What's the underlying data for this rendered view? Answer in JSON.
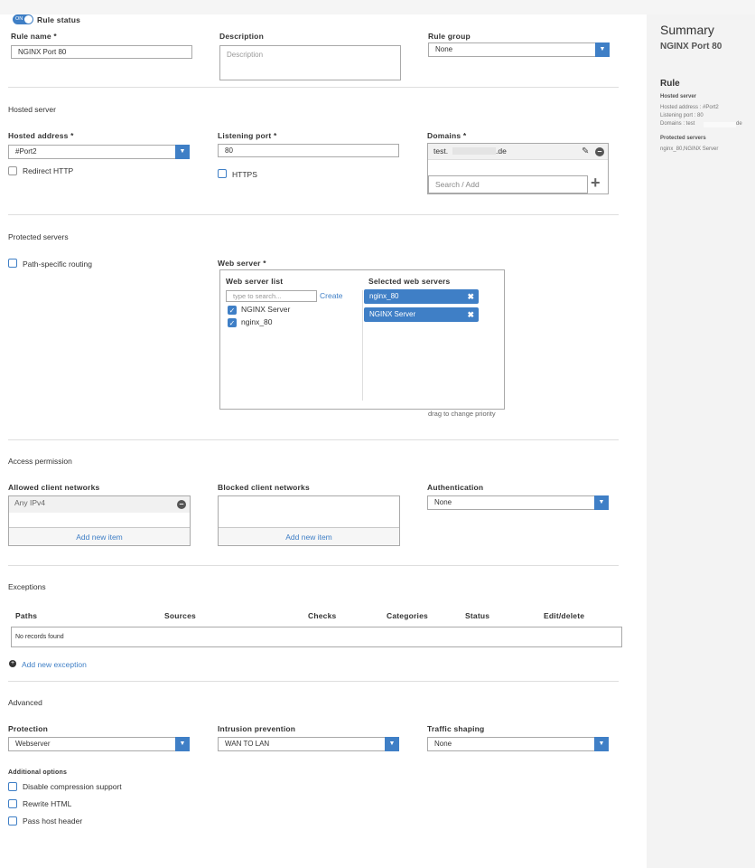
{
  "rule": {
    "status_label": "Rule status",
    "toggle_text": "ON",
    "name_label": "Rule name *",
    "name_value": "NGINX Port 80",
    "description_label": "Description",
    "description_placeholder": "Description",
    "group_label": "Rule group",
    "group_value": "None"
  },
  "hosted": {
    "title": "Hosted server",
    "address_label": "Hosted address *",
    "address_value": "#Port2",
    "redirect_http": "Redirect HTTP",
    "port_label": "Listening port *",
    "port_value": "80",
    "https_label": "HTTPS",
    "domains_label": "Domains *",
    "domain_prefix": "test.",
    "domain_suffix": ".de",
    "domain_search_placeholder": "Search / Add"
  },
  "protected": {
    "title": "Protected servers",
    "path_routing": "Path-specific routing",
    "web_server_label": "Web server *",
    "list_title": "Web server list",
    "search_placeholder": "type to search...",
    "create_link": "Create",
    "list_items": [
      "NGINX Server",
      "nginx_80"
    ],
    "selected_title": "Selected web servers",
    "selected_items": [
      "nginx_80",
      "NGINX Server"
    ],
    "drag_hint": "drag to change priority"
  },
  "access": {
    "title": "Access permission",
    "allowed_label": "Allowed client networks",
    "allowed_item": "Any IPv4",
    "add_item": "Add new item",
    "blocked_label": "Blocked client networks",
    "auth_label": "Authentication",
    "auth_value": "None"
  },
  "exceptions": {
    "title": "Exceptions",
    "columns": [
      "Paths",
      "Sources",
      "Checks",
      "Categories",
      "Status",
      "Edit/delete"
    ],
    "empty": "No records found",
    "add_exception": "Add new exception"
  },
  "advanced": {
    "title": "Advanced",
    "protection_label": "Protection",
    "protection_value": "Webserver",
    "ips_label": "Intrusion prevention",
    "ips_value": "WAN TO LAN",
    "shaping_label": "Traffic shaping",
    "shaping_value": "None",
    "additional_label": "Additional options",
    "options": [
      "Disable compression support",
      "Rewrite HTML",
      "Pass host header"
    ]
  },
  "summary": {
    "title": "Summary",
    "rule_name": "NGINX Port 80",
    "rule_heading": "Rule",
    "hosted_heading": "Hosted server",
    "hosted_address": "Hosted address : #Port2",
    "listening_port": "Listening port : 80",
    "domains_prefix": "Domains : test",
    "domains_suffix": "de",
    "protected_heading": "Protected servers",
    "protected_value": "nginx_80,NGINX Server"
  },
  "colors": {
    "accent": "#3f7fc6",
    "sidebar_bg": "#f3f3f3"
  }
}
